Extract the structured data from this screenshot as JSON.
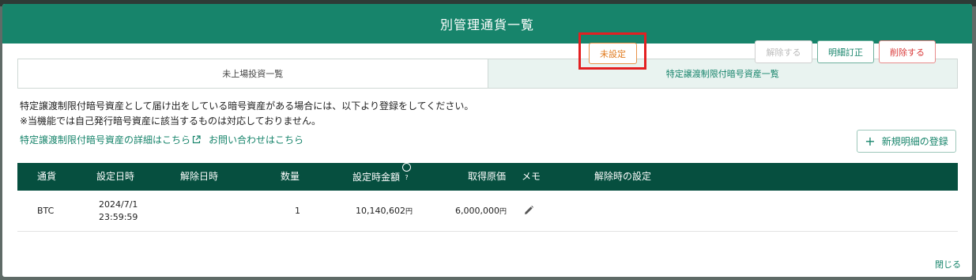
{
  "dialog": {
    "title": "別管理通貨一覧",
    "tabs": [
      {
        "label": "未上場投資一覧",
        "active": false
      },
      {
        "label": "特定譲渡制限付暗号資産一覧",
        "active": true
      }
    ],
    "notice_lines": [
      "特定譲渡制限付暗号資産として届け出をしている暗号資産がある場合には、以下より登録をしてください。",
      "※当機能では自己発行暗号資産に該当するものは対応しておりません。"
    ],
    "links": {
      "details": "特定譲渡制限付暗号資産の詳細はこちら",
      "contact": "お問い合わせはこちら"
    },
    "new_button": "新規明細の登録",
    "table": {
      "headers": {
        "currency": "通貨",
        "set_date": "設定日時",
        "release_date": "解除日時",
        "quantity": "数量",
        "set_amount": "設定時金額",
        "cost": "取得原価",
        "memo": "メモ",
        "release_setting": "解除時の設定"
      },
      "rows": [
        {
          "currency": "BTC",
          "set_date": "2024/7/1",
          "set_time": "23:59:59",
          "release_date": "",
          "quantity": "1",
          "set_amount": "10,140,602",
          "set_amount_unit": "円",
          "cost": "6,000,000",
          "cost_unit": "円",
          "release_setting": "未設定",
          "actions": {
            "release": "解除する",
            "edit": "明細訂正",
            "delete": "削除する"
          }
        }
      ]
    },
    "close": "閉じる"
  },
  "colors": {
    "header": "#17846b",
    "table_header": "#064f3f",
    "accent": "#17846b",
    "highlight": "#e32022",
    "unset": "#e07a1e",
    "delete": "#d93a3a"
  },
  "icons": [
    "external-link-icon",
    "plus-icon",
    "help-circle-icon",
    "pencil-icon"
  ]
}
